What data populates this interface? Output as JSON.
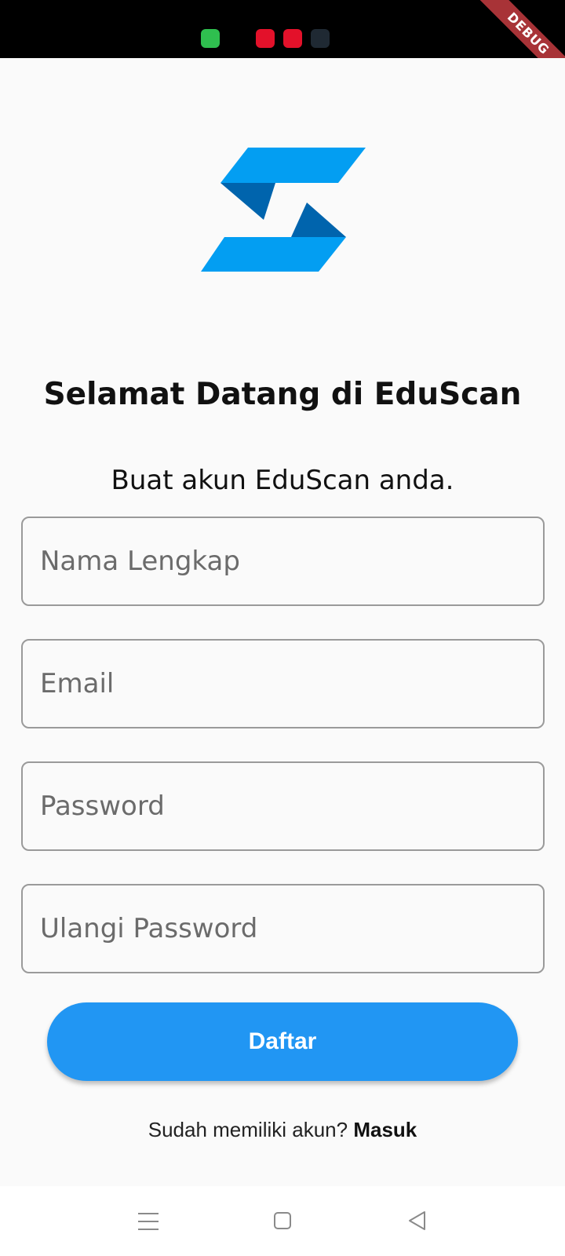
{
  "status_bar": {
    "icons": [
      "shopping-bag-icon",
      "app-t-icon",
      "app-o-icon",
      "app-drone-icon"
    ]
  },
  "debug_banner": "DEBUG",
  "logo": {
    "name": "eduscan-logo",
    "colors": {
      "primary": "#039ef2",
      "dark": "#0064ad"
    }
  },
  "title": "Selamat Datang di EduScan",
  "subtitle": "Buat akun EduScan anda.",
  "form": {
    "name_placeholder": "Nama Lengkap",
    "email_placeholder": "Email",
    "password_placeholder": "Password",
    "repeat_password_placeholder": "Ulangi Password",
    "submit_label": "Daftar"
  },
  "footer": {
    "prompt": "Sudah memiliki akun?",
    "link_label": "Masuk"
  },
  "nav_bar": {
    "icons": [
      "menu-icon",
      "home-icon",
      "back-icon"
    ]
  },
  "colors": {
    "accent": "#2196f3",
    "background": "#fafafa",
    "debug": "#a83337"
  }
}
